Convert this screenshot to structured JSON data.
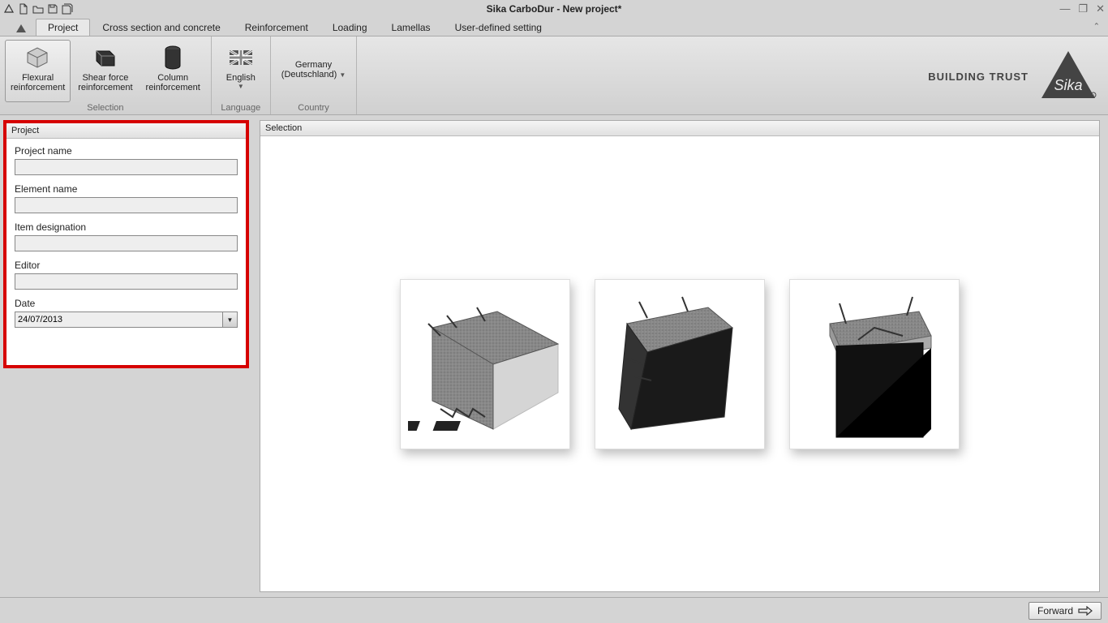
{
  "app": {
    "title": "Sika CarboDur - New project*"
  },
  "tabs": {
    "logo": "▲",
    "items": [
      "Project",
      "Cross section and concrete",
      "Reinforcement",
      "Loading",
      "Lamellas",
      "User-defined setting"
    ],
    "active": 0
  },
  "ribbon": {
    "selection": {
      "label": "Selection",
      "buttons": [
        {
          "label": "Flexural\nreinforcement",
          "active": true
        },
        {
          "label": "Shear force\nreinforcement",
          "active": false
        },
        {
          "label": "Column\nreinforcement",
          "active": false
        }
      ]
    },
    "language": {
      "label": "Language",
      "button": "English"
    },
    "country": {
      "label": "Country",
      "button": "Germany\n(Deutschland)"
    },
    "brand_tag": "BUILDING TRUST"
  },
  "project_panel": {
    "header": "Project",
    "fields": {
      "project_name": {
        "label": "Project name",
        "value": ""
      },
      "element_name": {
        "label": "Element name",
        "value": ""
      },
      "item_designation": {
        "label": "Item designation",
        "value": ""
      },
      "editor": {
        "label": "Editor",
        "value": ""
      },
      "date": {
        "label": "Date",
        "value": "24/07/2013"
      }
    }
  },
  "selection_panel": {
    "header": "Selection",
    "options": [
      "flexural-beam",
      "shear-beam",
      "column"
    ]
  },
  "footer": {
    "forward": "Forward"
  }
}
